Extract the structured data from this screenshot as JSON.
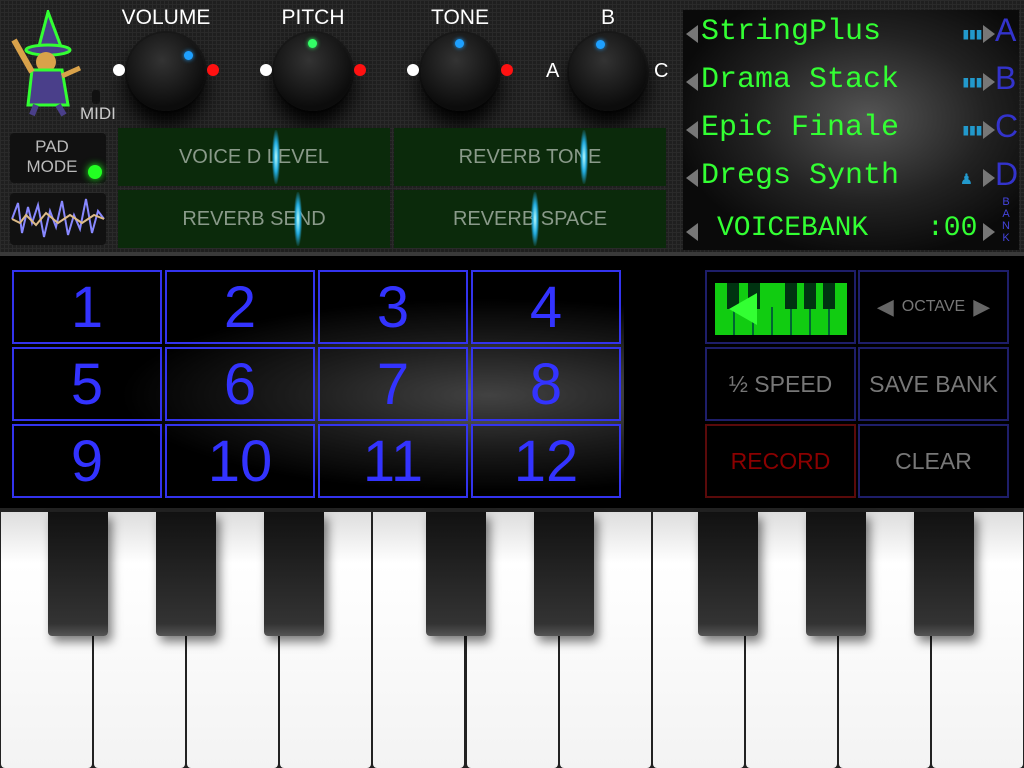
{
  "app": {
    "midi_label": "MIDI",
    "pad_mode_label_1": "PAD",
    "pad_mode_label_2": "MODE",
    "pad_mode_on": true
  },
  "knobs": [
    {
      "label": "VOLUME",
      "value": 0.7,
      "dot_color": "#1ea0ff"
    },
    {
      "label": "PITCH",
      "value": 0.5,
      "dot_color": "#3f6"
    },
    {
      "label": "TONE",
      "value": 0.5,
      "dot_color": "#1ea0ff"
    },
    {
      "label": "B",
      "value": 0.45,
      "dot_color": "#1ea0ff",
      "left_label": "A",
      "right_label": "C"
    }
  ],
  "sliders": [
    {
      "label": "VOICE D LEVEL",
      "value": 0.58
    },
    {
      "label": "REVERB TONE",
      "value": 0.7
    },
    {
      "label": "REVERB SEND",
      "value": 0.66
    },
    {
      "label": "REVERB SPACE",
      "value": 0.52
    }
  ],
  "voices": [
    {
      "name": "StringPlus",
      "slot": "A",
      "icon": "volume-icon"
    },
    {
      "name": "Drama Stack",
      "slot": "B",
      "icon": "volume-icon"
    },
    {
      "name": "Epic Finale",
      "slot": "C",
      "icon": "volume-icon"
    },
    {
      "name": "Dregs Synth",
      "slot": "D",
      "icon": "wizard-icon"
    }
  ],
  "voicebank": {
    "label": "VOICEBANK",
    "number": ":00",
    "bank_label": "BANK"
  },
  "pads": [
    "1",
    "2",
    "3",
    "4",
    "5",
    "6",
    "7",
    "8",
    "9",
    "10",
    "11",
    "12"
  ],
  "controls": {
    "octave": "OCTAVE",
    "half_speed": "½ SPEED",
    "save_bank": "SAVE BANK",
    "record": "RECORD",
    "clear": "CLEAR"
  },
  "colors": {
    "display_text": "#33ff33",
    "pad": "#3333ff",
    "record": "#8b0000"
  }
}
